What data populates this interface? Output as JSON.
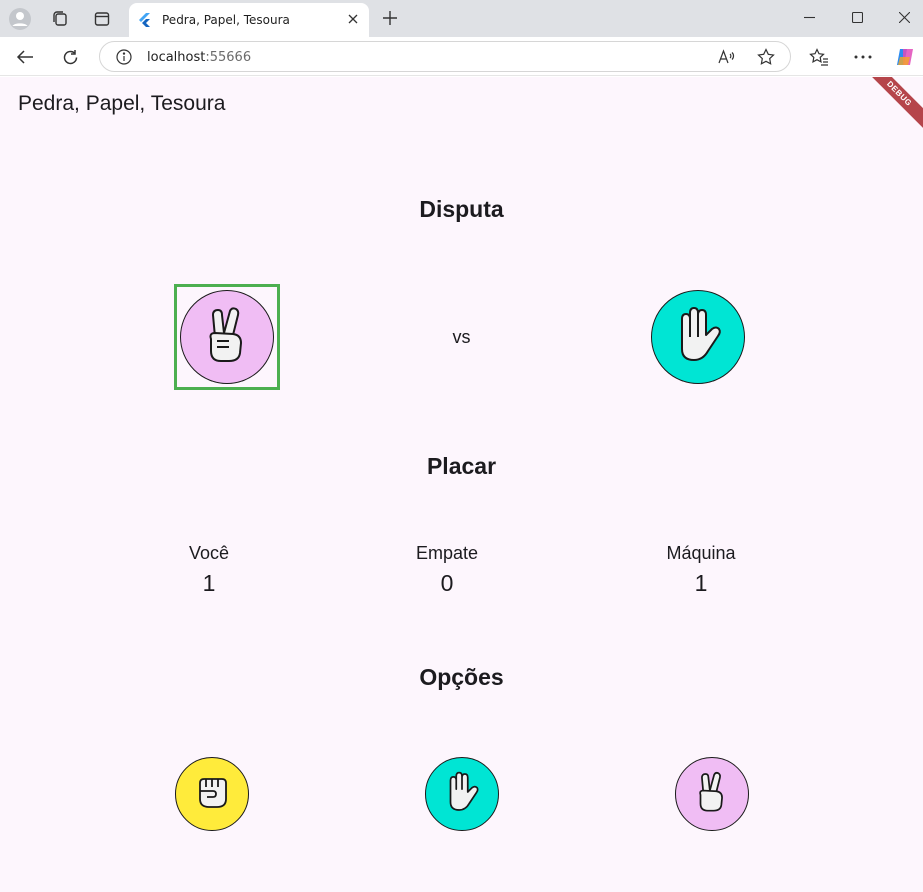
{
  "browser": {
    "tab_title": "Pedra, Papel, Tesoura",
    "url_host": "localhost",
    "url_port": ":55666"
  },
  "app": {
    "title": "Pedra, Papel, Tesoura",
    "debug_banner": "DEBUG"
  },
  "disputa": {
    "heading": "Disputa",
    "vs": "vs",
    "player_choice": "scissors-hand-icon",
    "machine_choice": "paper-hand-icon"
  },
  "placar": {
    "heading": "Placar",
    "scores": [
      {
        "label": "Você",
        "value": "1"
      },
      {
        "label": "Empate",
        "value": "0"
      },
      {
        "label": "Máquina",
        "value": "1"
      }
    ]
  },
  "opcoes": {
    "heading": "Opções",
    "items": [
      "rock-hand-icon",
      "paper-hand-icon",
      "scissors-hand-icon"
    ]
  },
  "colors": {
    "rock": "#ffeb3b",
    "paper": "#00e5d4",
    "scissors": "#f0bdf4",
    "selected": "#4caf50",
    "app_bg": "#fdf6fd"
  }
}
